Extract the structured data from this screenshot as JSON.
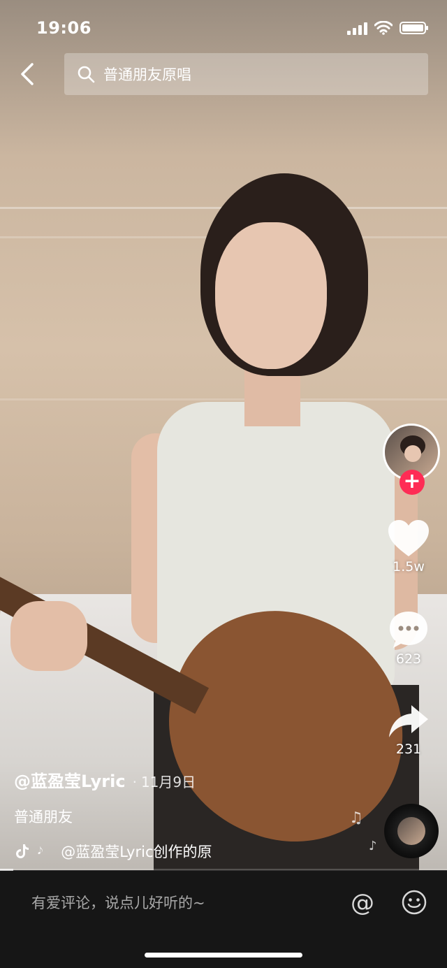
{
  "status_bar": {
    "time": "19:06"
  },
  "search": {
    "query": "普通朋友原唱"
  },
  "video": {
    "author": "@蓝盈莹Lyric",
    "separator": "·",
    "date": "11月9日",
    "description": "普通朋友",
    "music_prefix": "𝅘𝅥𝅮",
    "music": "@蓝盈莹Lyric创作的原",
    "progress_fraction": 0.03
  },
  "actions": {
    "follow": "+",
    "likes": "1.5w",
    "comments": "623",
    "shares": "231"
  },
  "comment_bar": {
    "placeholder": "有爱评论，说点儿好听的~",
    "at": "@"
  },
  "colors": {
    "follow_red": "#fe2c55",
    "bar_bg": "#161616"
  },
  "icons": [
    "back-icon",
    "search-icon",
    "heart-icon",
    "comment-icon",
    "share-icon",
    "tiktok-icon",
    "music-disc-icon",
    "at-icon",
    "emoji-icon"
  ]
}
